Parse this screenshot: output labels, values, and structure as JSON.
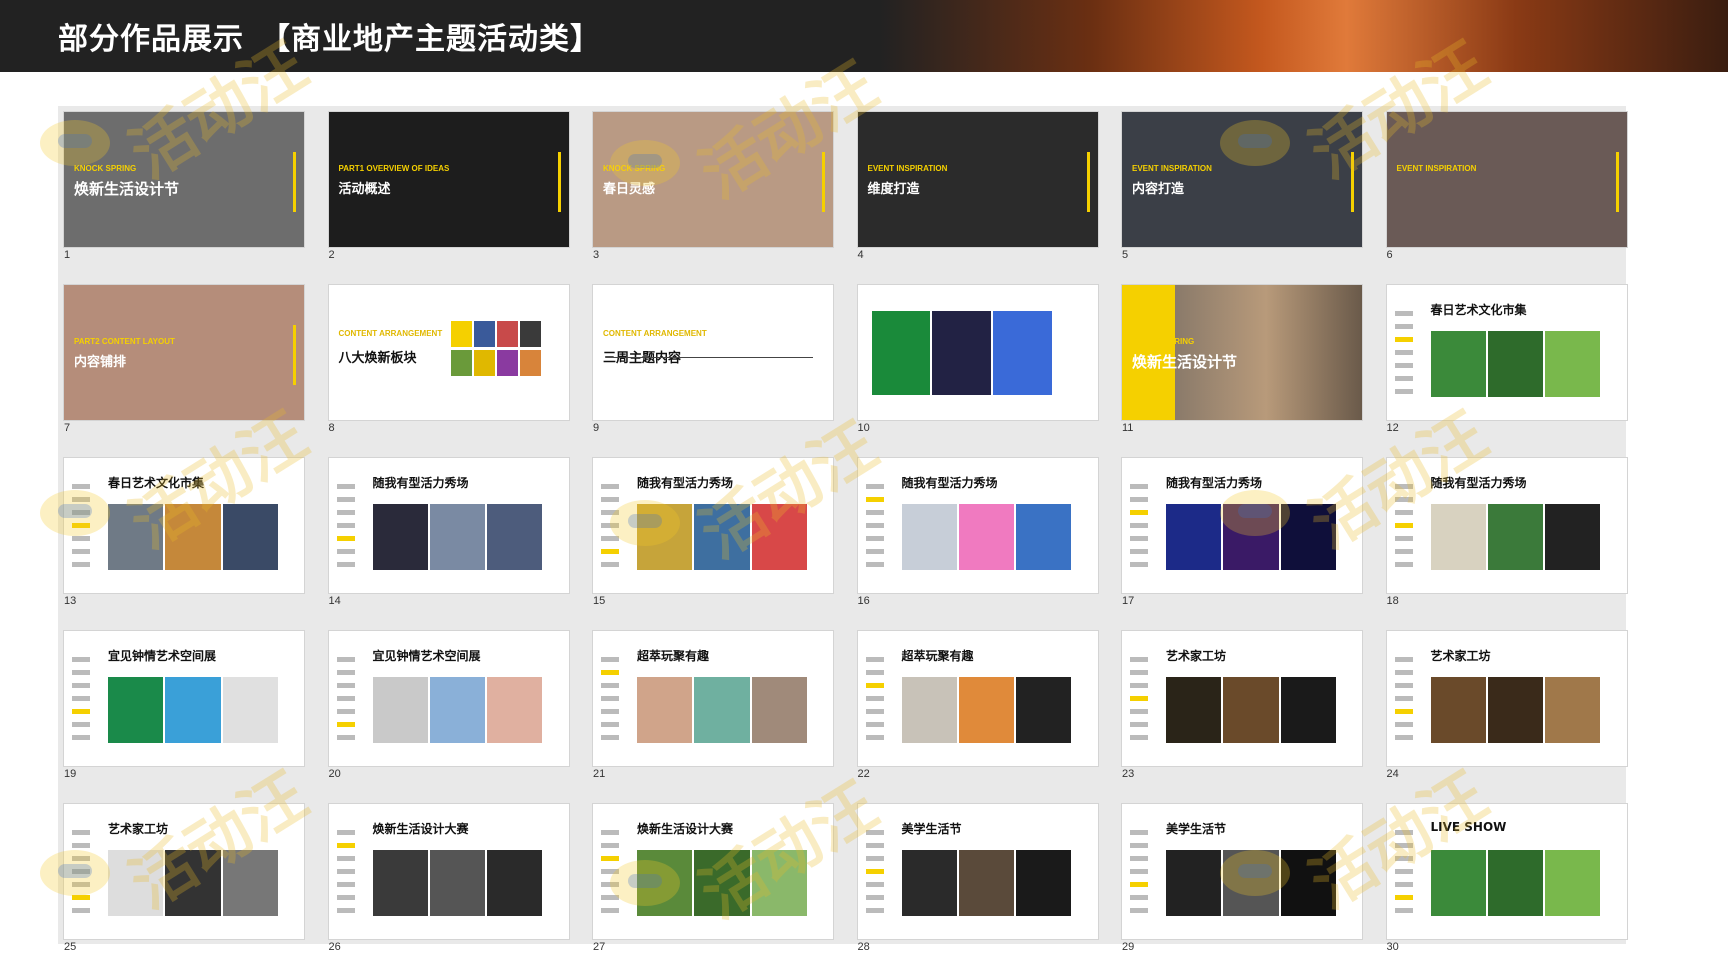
{
  "header": {
    "title": "部分作品展示　【商业地产主题活动类】"
  },
  "slides": [
    {
      "n": "1",
      "t": "焕新生活设计节",
      "en": "KNOCK SPRING"
    },
    {
      "n": "2",
      "t": "活动概述",
      "en": "PART1 OVERVIEW OF IDEAS"
    },
    {
      "n": "3",
      "t": "春日灵感",
      "en": "KNOCK SPRING"
    },
    {
      "n": "4",
      "t": "维度打造",
      "en": "EVENT INSPIRATION"
    },
    {
      "n": "5",
      "t": "内容打造",
      "en": "EVENT INSPIRATION"
    },
    {
      "n": "6",
      "t": "",
      "en": "EVENT INSPIRATION"
    },
    {
      "n": "7",
      "t": "内容铺排",
      "en": "PART2 CONTENT LAYOUT"
    },
    {
      "n": "8",
      "t": "八大焕新板块",
      "en": "CONTENT ARRANGEMENT"
    },
    {
      "n": "9",
      "t": "三周主题内容",
      "en": "CONTENT ARRANGEMENT"
    },
    {
      "n": "10",
      "t": "",
      "en": ""
    },
    {
      "n": "11",
      "t": "焕新生活设计节",
      "en": "KNOCK SPRING"
    },
    {
      "n": "12",
      "t": "春日艺术文化市集",
      "en": ""
    },
    {
      "n": "13",
      "t": "春日艺术文化市集",
      "en": ""
    },
    {
      "n": "14",
      "t": "随我有型活力秀场",
      "en": ""
    },
    {
      "n": "15",
      "t": "随我有型活力秀场",
      "en": ""
    },
    {
      "n": "16",
      "t": "随我有型活力秀场",
      "en": ""
    },
    {
      "n": "17",
      "t": "随我有型活力秀场",
      "en": ""
    },
    {
      "n": "18",
      "t": "随我有型活力秀场",
      "en": ""
    },
    {
      "n": "19",
      "t": "宜见钟情艺术空间展",
      "en": ""
    },
    {
      "n": "20",
      "t": "宜见钟情艺术空间展",
      "en": ""
    },
    {
      "n": "21",
      "t": "超萃玩聚有趣",
      "en": ""
    },
    {
      "n": "22",
      "t": "超萃玩聚有趣",
      "en": ""
    },
    {
      "n": "23",
      "t": "艺术家工坊",
      "en": ""
    },
    {
      "n": "24",
      "t": "艺术家工坊",
      "en": ""
    },
    {
      "n": "25",
      "t": "艺术家工坊",
      "en": ""
    },
    {
      "n": "26",
      "t": "焕新生活设计大赛",
      "en": ""
    },
    {
      "n": "27",
      "t": "焕新生活设计大赛",
      "en": ""
    },
    {
      "n": "28",
      "t": "美学生活节",
      "en": ""
    },
    {
      "n": "29",
      "t": "美学生活节",
      "en": ""
    },
    {
      "n": "30",
      "t": "LIVE SHOW",
      "en": ""
    }
  ],
  "watermark": {
    "text": "活动汪"
  },
  "colors": {
    "accent": "#f5d000",
    "header_bg": "#222222",
    "gallery_bg": "#e9e9e9"
  }
}
